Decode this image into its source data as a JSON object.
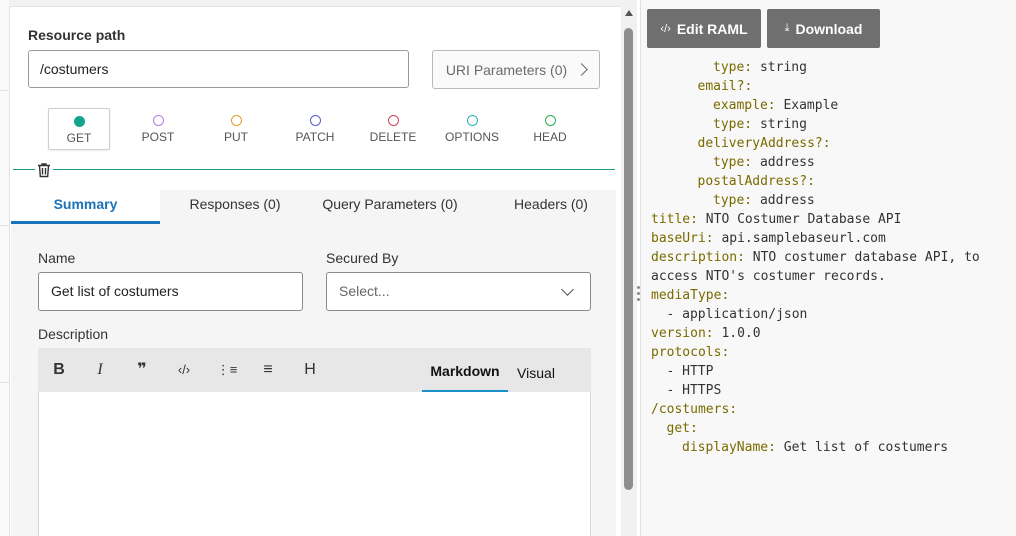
{
  "resource": {
    "path_label": "Resource path",
    "path_value": "/costumers",
    "uri_button": "URI Parameters (0)"
  },
  "methods": [
    {
      "label": "GET",
      "color": "#12a48b",
      "active": true
    },
    {
      "label": "POST",
      "color": "#b07ee0",
      "active": false
    },
    {
      "label": "PUT",
      "color": "#e3a12a",
      "active": false
    },
    {
      "label": "PATCH",
      "color": "#5a5cc8",
      "active": false
    },
    {
      "label": "DELETE",
      "color": "#d0445a",
      "active": false
    },
    {
      "label": "OPTIONS",
      "color": "#26b5b0",
      "active": false
    },
    {
      "label": "HEAD",
      "color": "#2eaa55",
      "active": false
    }
  ],
  "tabs": [
    {
      "label": "Summary",
      "active": true
    },
    {
      "label": "Responses (0)",
      "active": false
    },
    {
      "label": "Query Parameters (0)",
      "active": false
    },
    {
      "label": "Headers (0)",
      "active": false
    }
  ],
  "form": {
    "name_label": "Name",
    "name_value": "Get list of costumers",
    "secured_label": "Secured By",
    "secured_placeholder": "Select...",
    "description_label": "Description"
  },
  "editor": {
    "toolbar": [
      "bold-icon",
      "italic-icon",
      "quote-icon",
      "code-icon",
      "ordered-list-icon",
      "bullet-list-icon",
      "heading-icon"
    ],
    "toolbar_glyphs": [
      "B",
      "I",
      "❞",
      "‹/›",
      "⋮≡",
      "≡",
      "H"
    ],
    "modes": [
      {
        "label": "Markdown",
        "active": true
      },
      {
        "label": "Visual",
        "active": false
      }
    ]
  },
  "raml_panel": {
    "edit_button": "Edit RAML",
    "download_button": "Download",
    "lines": [
      {
        "indent": 4,
        "key": "type:",
        "value": " string"
      },
      {
        "indent": 3,
        "key": "email?:",
        "value": ""
      },
      {
        "indent": 4,
        "key": "example:",
        "value": " Example"
      },
      {
        "indent": 4,
        "key": "type:",
        "value": " string"
      },
      {
        "indent": 3,
        "key": "deliveryAddress?:",
        "value": ""
      },
      {
        "indent": 4,
        "key": "type:",
        "value": " address"
      },
      {
        "indent": 3,
        "key": "postalAddress?:",
        "value": ""
      },
      {
        "indent": 4,
        "key": "type:",
        "value": " address"
      },
      {
        "indent": 0,
        "key": "title:",
        "value": " NTO Costumer Database API"
      },
      {
        "indent": 0,
        "key": "baseUri:",
        "value": " api.samplebaseurl.com"
      },
      {
        "indent": 0,
        "key": "description:",
        "value": " NTO costumer database API, to"
      },
      {
        "indent": 0,
        "key": "",
        "value": "access NTO's costumer records."
      },
      {
        "indent": 0,
        "key": "mediaType:",
        "value": ""
      },
      {
        "indent": 1,
        "key": "",
        "value": "- application/json"
      },
      {
        "indent": 0,
        "key": "version:",
        "value": " 1.0.0"
      },
      {
        "indent": 0,
        "key": "protocols:",
        "value": ""
      },
      {
        "indent": 1,
        "key": "",
        "value": "- HTTP"
      },
      {
        "indent": 1,
        "key": "",
        "value": "- HTTPS"
      },
      {
        "indent": 0,
        "key": "/costumers:",
        "value": ""
      },
      {
        "indent": 1,
        "key": "get:",
        "value": ""
      },
      {
        "indent": 2,
        "key": "displayName:",
        "value": " Get list of costumers"
      }
    ]
  }
}
